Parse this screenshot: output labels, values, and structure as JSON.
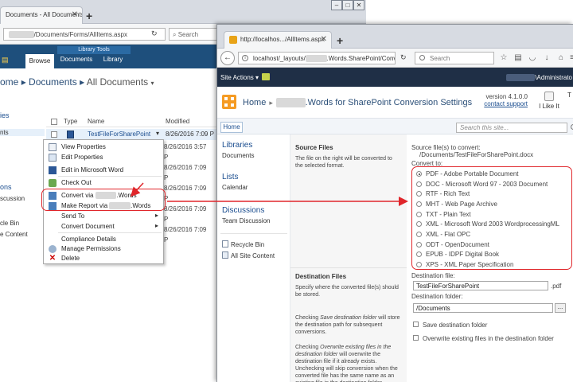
{
  "back_window": {
    "tab_title": "Documents - All Documents",
    "url_suffix": "/Documents/Forms/AllItems.aspx",
    "search_placeholder": "Search",
    "ribbon": {
      "tools_label": "Library Tools",
      "tabs": [
        "Browse",
        "Documents",
        "Library"
      ]
    },
    "breadcrumb": {
      "site": "ome",
      "list": "Documents",
      "view": "All Documents"
    },
    "columns": [
      "Type",
      "Name",
      "Modified"
    ],
    "row": {
      "name": "TestFileForSharePoint",
      "modified": "8/26/2016 7:09 P"
    },
    "other_dates": [
      "8/26/2016 3:57 P",
      "8/26/2016 7:09 P",
      "8/26/2016 7:09 P",
      "8/26/2016 7:09 P",
      "8/26/2016 7:09 P"
    ],
    "left_nav": [
      "ies",
      "nts",
      "ons",
      "scussion",
      "cle Bin",
      "e Content"
    ],
    "context_menu": {
      "items": [
        {
          "label": "View Properties",
          "icon": "view-properties-icon"
        },
        {
          "label": "Edit Properties",
          "icon": "edit-properties-icon"
        },
        {
          "label": "Edit in Microsoft Word",
          "icon": "word-icon"
        },
        {
          "label": "Check Out",
          "icon": "check-out-icon"
        },
        {
          "label_prefix": "Convert via",
          "label_suffix": ".Words",
          "icon": "convert-icon"
        },
        {
          "label_prefix": "Make Report via",
          "label_suffix": ".Words",
          "icon": "report-icon"
        },
        {
          "label": "Send To",
          "icon": "",
          "submenu": true
        },
        {
          "label": "Convert Document",
          "icon": "",
          "submenu": true
        },
        {
          "label": "Compliance Details",
          "icon": ""
        },
        {
          "label": "Manage Permissions",
          "icon": "permissions-icon"
        },
        {
          "label": "Delete",
          "icon": "delete-icon"
        }
      ]
    }
  },
  "front_window": {
    "tab_title": "http://localhos.../AllItems.aspx",
    "url_prefix": "localhost/_layouts/",
    "url_suffix": ".Words.SharePoint/Conv",
    "search_placeholder": "Search",
    "site_actions": "Site Actions",
    "user": "\\Administrato",
    "breadcrumb": {
      "home": "Home",
      "page_suffix": ".Words for SharePoint Conversion Settings"
    },
    "version": "version 4.1.0.0",
    "contact_support": "contact support",
    "like_it": "I Like It",
    "like_t": "T",
    "home_tab": "Home",
    "site_search_placeholder": "Search this site...",
    "nav": {
      "libraries_heading": "Libraries",
      "documents": "Documents",
      "lists_heading": "Lists",
      "calendar": "Calendar",
      "discussions_heading": "Discussions",
      "team_discussion": "Team Discussion",
      "recycle_bin": "Recycle Bin",
      "all_site_content": "All Site Content"
    },
    "source_section": {
      "title": "Source Files",
      "description": "The file on the right will be converted to the selected format.",
      "source_label": "Source file(s) to convert:",
      "source_path": "/Documents/TestFileForSharePoint.docx",
      "convert_to_label": "Convert to:",
      "formats": [
        "PDF - Adobe Portable Document",
        "DOC - Microsoft Word 97 - 2003 Document",
        "RTF - Rich Text",
        "MHT - Web Page Archive",
        "TXT - Plain Text",
        "XML - Microsoft Word 2003 WordprocessingML",
        "XML - Flat OPC",
        "ODT - OpenDocument",
        "EPUB - IDPF Digital Book",
        "XPS - XML Paper Specification"
      ],
      "selected_format_index": 0
    },
    "destination_section": {
      "title": "Destination Files",
      "description": "Specify where the converted file(s) should be stored.",
      "note1_a": "Checking ",
      "note1_i": "Save destination folder",
      "note1_b": " will store the destination path for subsequent conversions.",
      "note2_a": "Checking ",
      "note2_i": "Overwrite existing files in the destination folder",
      "note2_b": " will overwrite the destination file if it already exists. Unchecking will skip conversion when the converted file has the same name as an existing file in the destination folder.",
      "dest_file_label": "Destination file:",
      "dest_file_value": "TestFileForSharePoint",
      "dest_file_ext": ".pdf",
      "dest_folder_label": "Destination folder:",
      "dest_folder_value": "/Documents",
      "browse_label": "...",
      "save_folder_label": "Save destination folder",
      "overwrite_label": "Overwrite existing files in the destination folder"
    }
  },
  "colors": {
    "highlight": "#e0262b",
    "ribbon_blue": "#1e4f7c",
    "site_actions_bar": "#1f2f46",
    "link_blue": "#1a4d8f"
  }
}
